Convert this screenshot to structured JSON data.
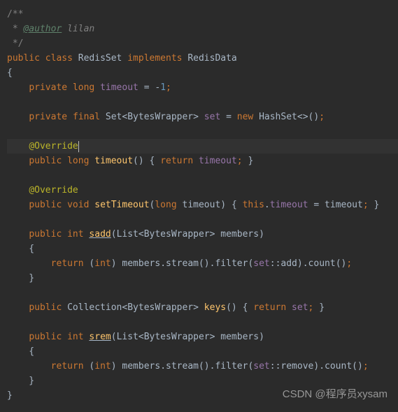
{
  "code": {
    "doc": {
      "open": "/**",
      "author_tag": "@author",
      "author_name": " lilan",
      "star": " * ",
      "close": " */"
    },
    "class_decl": {
      "public": "public ",
      "class": "class ",
      "name": "RedisSet ",
      "implements": "implements ",
      "iface": "RedisData"
    },
    "brace_open": "{",
    "brace_close": "}",
    "timeout_field": {
      "indent": "    ",
      "private": "private ",
      "long": "long ",
      "name": "timeout",
      "eq": " = ",
      "minus": "-",
      "one": "1",
      "semi": ";"
    },
    "set_field": {
      "indent": "    ",
      "private": "private ",
      "final": "final ",
      "set": "Set",
      "lt": "<",
      "bw": "BytesWrapper",
      "gt": "> ",
      "name": "set",
      "eq": " = ",
      "new": "new ",
      "hashset": "HashSet",
      "diamond": "<>()",
      "semi": ";"
    },
    "override": "@Override",
    "timeout_method": {
      "indent": "    ",
      "public": "public ",
      "long": "long ",
      "name": "timeout",
      "parens": "() ",
      "open": "{ ",
      "return": "return ",
      "field": "timeout",
      "semi": "; ",
      "close": "}"
    },
    "settimeout_method": {
      "indent": "    ",
      "public": "public ",
      "void": "void ",
      "name": "setTimeout",
      "open_paren": "(",
      "long": "long ",
      "param": "timeout",
      "close_paren": ") ",
      "open": "{ ",
      "this": "this",
      "dot": ".",
      "field": "timeout",
      "eq": " = ",
      "val": "timeout",
      "semi": "; ",
      "close": "}"
    },
    "sadd_method": {
      "indent": "    ",
      "public": "public ",
      "int": "int ",
      "name": "sadd",
      "open_paren": "(",
      "list": "List",
      "lt": "<",
      "bw": "BytesWrapper",
      "gt": "> ",
      "param": "members",
      "close_paren": ")"
    },
    "sadd_body": {
      "indent": "        ",
      "return": "return ",
      "open_cast": "(",
      "int": "int",
      "close_cast": ") ",
      "members": "members",
      "dot1": ".",
      "stream": "stream",
      "p1": "()",
      "dot2": ".",
      "filter": "filter",
      "open_p": "(",
      "set": "set",
      "ref": "::",
      "add": "add",
      "close_p": ")",
      "dot3": ".",
      "count": "count",
      "p2": "()",
      "semi": ";"
    },
    "keys_method": {
      "indent": "    ",
      "public": "public ",
      "coll": "Collection",
      "lt": "<",
      "bw": "BytesWrapper",
      "gt": "> ",
      "name": "keys",
      "parens": "() ",
      "open": "{ ",
      "return": "return ",
      "set": "set",
      "semi": "; ",
      "close": "}"
    },
    "srem_method": {
      "indent": "    ",
      "public": "public ",
      "int": "int ",
      "name": "srem",
      "open_paren": "(",
      "list": "List",
      "lt": "<",
      "bw": "BytesWrapper",
      "gt": "> ",
      "param": "members",
      "close_paren": ")"
    },
    "srem_body": {
      "indent": "        ",
      "return": "return ",
      "open_cast": "(",
      "int": "int",
      "close_cast": ") ",
      "members": "members",
      "dot1": ".",
      "stream": "stream",
      "p1": "()",
      "dot2": ".",
      "filter": "filter",
      "open_p": "(",
      "set": "set",
      "ref": "::",
      "remove": "remove",
      "close_p": ")",
      "dot3": ".",
      "count": "count",
      "p2": "()",
      "semi": ";"
    },
    "inner_brace_open": "    {",
    "inner_brace_close": "    }"
  },
  "watermark": "CSDN @程序员xysam"
}
